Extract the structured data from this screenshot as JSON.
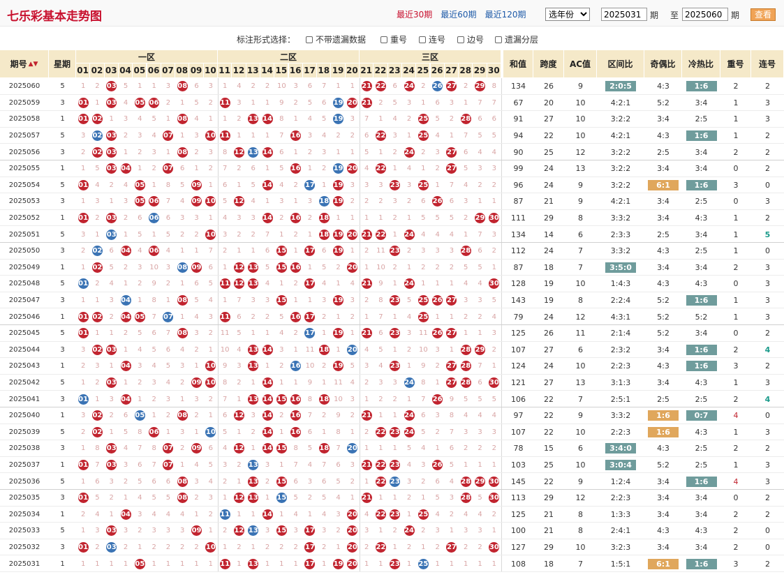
{
  "title": "七乐彩基本走势图",
  "ranges": [
    "最近30期",
    "最近60期",
    "最近120期"
  ],
  "year_select": "选年份",
  "period_from": "2025031",
  "period_to": "2025060",
  "label_qi": "期",
  "label_zhi": "至",
  "query_button": "查看",
  "mark_label": "标注形式选择：",
  "mark_options": [
    "不带遗漏数据",
    "重号",
    "连号",
    "边号",
    "遗漏分层"
  ],
  "zones": [
    "一区",
    "二区",
    "三区"
  ],
  "headers": {
    "period": "期号",
    "week": "星期",
    "sum": "和值",
    "span": "跨度",
    "ac": "AC值",
    "zone_ratio": "区间比",
    "odd_even": "奇偶比",
    "hot_cold": "冷热比",
    "repeat": "重号",
    "consecutive": "连号"
  },
  "sort_icon": "sort-icon",
  "colors": {
    "red_ball": "#c1242f",
    "blue_ball": "#3a73b4",
    "header_bg": "#f5e9c9",
    "teal_badge": "#6f9c9c",
    "orange_badge": "#e0a75c"
  },
  "rows": [
    {
      "p": "2025060",
      "w": "5",
      "red": [
        3,
        8,
        21,
        22,
        24,
        27,
        29
      ],
      "blue": [
        26
      ],
      "sum": "134",
      "span": "26",
      "ac": "9",
      "zr": "2:0:5",
      "oe": "4:3",
      "hc": "1:6",
      "rep": "2",
      "con": "2"
    },
    {
      "p": "2025059",
      "w": "3",
      "red": [
        1,
        3,
        5,
        6,
        11,
        20,
        21
      ],
      "blue": [
        19
      ],
      "sum": "67",
      "span": "20",
      "ac": "10",
      "zr": "4:2:1",
      "oe": "5:2",
      "hc": "3:4",
      "rep": "1",
      "con": "3"
    },
    {
      "p": "2025058",
      "w": "1",
      "red": [
        1,
        2,
        8,
        13,
        14,
        25,
        28
      ],
      "blue": [
        19
      ],
      "sum": "91",
      "span": "27",
      "ac": "10",
      "zr": "3:2:2",
      "oe": "3:4",
      "hc": "2:5",
      "rep": "1",
      "con": "3"
    },
    {
      "p": "2025057",
      "w": "5",
      "red": [
        3,
        7,
        10,
        11,
        16,
        22,
        25
      ],
      "blue": [
        2
      ],
      "sum": "94",
      "span": "22",
      "ac": "10",
      "zr": "4:2:1",
      "oe": "4:3",
      "hc": "1:6",
      "rep": "1",
      "con": "2"
    },
    {
      "p": "2025056",
      "w": "3",
      "red": [
        2,
        3,
        8,
        12,
        14,
        24,
        27
      ],
      "blue": [
        13
      ],
      "sum": "90",
      "span": "25",
      "ac": "12",
      "zr": "3:2:2",
      "oe": "2:5",
      "hc": "3:4",
      "rep": "2",
      "con": "2"
    },
    {
      "p": "2025055",
      "w": "1",
      "red": [
        3,
        4,
        7,
        16,
        20,
        22,
        27
      ],
      "blue": [
        19
      ],
      "sum": "99",
      "span": "24",
      "ac": "13",
      "zr": "3:2:2",
      "oe": "3:4",
      "hc": "3:4",
      "rep": "0",
      "con": "2"
    },
    {
      "p": "2025054",
      "w": "5",
      "red": [
        1,
        5,
        9,
        14,
        19,
        23,
        25
      ],
      "blue": [
        17
      ],
      "sum": "96",
      "span": "24",
      "ac": "9",
      "zr": "3:2:2",
      "oe": "6:1",
      "hc": "1:6",
      "rep": "3",
      "con": "0"
    },
    {
      "p": "2025053",
      "w": "3",
      "red": [
        5,
        6,
        9,
        10,
        12,
        19,
        26
      ],
      "blue": [
        18
      ],
      "sum": "87",
      "span": "21",
      "ac": "9",
      "zr": "4:2:1",
      "oe": "3:4",
      "hc": "2:5",
      "rep": "0",
      "con": "3"
    },
    {
      "p": "2025052",
      "w": "1",
      "red": [
        1,
        3,
        14,
        16,
        18,
        29,
        30
      ],
      "blue": [
        6
      ],
      "sum": "111",
      "span": "29",
      "ac": "8",
      "zr": "3:3:2",
      "oe": "3:4",
      "hc": "4:3",
      "rep": "1",
      "con": "2"
    },
    {
      "p": "2025051",
      "w": "5",
      "red": [
        10,
        18,
        19,
        20,
        21,
        22,
        24
      ],
      "blue": [
        3
      ],
      "sum": "134",
      "span": "14",
      "ac": "6",
      "zr": "2:3:3",
      "oe": "2:5",
      "hc": "3:4",
      "rep": "1",
      "con": "5"
    },
    {
      "p": "2025050",
      "w": "3",
      "red": [
        4,
        6,
        15,
        17,
        19,
        23,
        28
      ],
      "blue": [
        2
      ],
      "sum": "112",
      "span": "24",
      "ac": "7",
      "zr": "3:3:2",
      "oe": "4:3",
      "hc": "2:5",
      "rep": "1",
      "con": "0"
    },
    {
      "p": "2025049",
      "w": "1",
      "red": [
        2,
        9,
        12,
        13,
        15,
        16,
        20
      ],
      "blue": [
        8
      ],
      "sum": "87",
      "span": "18",
      "ac": "7",
      "zr": "3:5:0",
      "oe": "3:4",
      "hc": "3:4",
      "rep": "2",
      "con": "3"
    },
    {
      "p": "2025048",
      "w": "5",
      "red": [
        11,
        12,
        13,
        17,
        21,
        24,
        30
      ],
      "blue": [
        1
      ],
      "sum": "128",
      "span": "19",
      "ac": "10",
      "zr": "1:4:3",
      "oe": "4:3",
      "hc": "4:3",
      "rep": "0",
      "con": "3"
    },
    {
      "p": "2025047",
      "w": "3",
      "red": [
        8,
        15,
        19,
        23,
        25,
        26,
        27
      ],
      "blue": [
        4
      ],
      "sum": "143",
      "span": "19",
      "ac": "8",
      "zr": "2:2:4",
      "oe": "5:2",
      "hc": "1:6",
      "rep": "1",
      "con": "3"
    },
    {
      "p": "2025046",
      "w": "1",
      "red": [
        1,
        2,
        4,
        5,
        11,
        16,
        17,
        25
      ],
      "blue": [
        7
      ],
      "sum": "79",
      "span": "24",
      "ac": "12",
      "zr": "4:3:1",
      "oe": "5:2",
      "hc": "5:2",
      "rep": "1",
      "con": "3"
    },
    {
      "p": "2025045",
      "w": "5",
      "red": [
        1,
        8,
        19,
        21,
        23,
        26,
        27
      ],
      "blue": [
        17
      ],
      "sum": "125",
      "span": "26",
      "ac": "11",
      "zr": "2:1:4",
      "oe": "5:2",
      "hc": "3:4",
      "rep": "0",
      "con": "2"
    },
    {
      "p": "2025044",
      "w": "3",
      "red": [
        2,
        3,
        13,
        14,
        18,
        28,
        29
      ],
      "blue": [
        20
      ],
      "sum": "107",
      "span": "27",
      "ac": "6",
      "zr": "2:3:2",
      "oe": "3:4",
      "hc": "1:6",
      "rep": "2",
      "con": "4"
    },
    {
      "p": "2025043",
      "w": "1",
      "red": [
        4,
        10,
        13,
        19,
        23,
        27,
        28
      ],
      "blue": [
        16
      ],
      "sum": "124",
      "span": "24",
      "ac": "10",
      "zr": "2:2:3",
      "oe": "4:3",
      "hc": "1:6",
      "rep": "3",
      "con": "2"
    },
    {
      "p": "2025042",
      "w": "5",
      "red": [
        3,
        9,
        10,
        14,
        27,
        28,
        30
      ],
      "blue": [
        24
      ],
      "sum": "121",
      "span": "27",
      "ac": "13",
      "zr": "3:1:3",
      "oe": "3:4",
      "hc": "4:3",
      "rep": "1",
      "con": "3"
    },
    {
      "p": "2025041",
      "w": "3",
      "red": [
        4,
        13,
        14,
        15,
        16,
        18,
        26
      ],
      "blue": [
        1
      ],
      "sum": "106",
      "span": "22",
      "ac": "7",
      "zr": "2:5:1",
      "oe": "2:5",
      "hc": "2:5",
      "rep": "2",
      "con": "4"
    },
    {
      "p": "2025040",
      "w": "1",
      "red": [
        2,
        8,
        12,
        14,
        16,
        21,
        24
      ],
      "blue": [
        5
      ],
      "sum": "97",
      "span": "22",
      "ac": "9",
      "zr": "3:3:2",
      "oe": "1:6",
      "hc": "0:7",
      "rep": "4",
      "con": "0"
    },
    {
      "p": "2025039",
      "w": "5",
      "red": [
        2,
        6,
        14,
        16,
        22,
        23,
        24
      ],
      "blue": [
        10
      ],
      "sum": "107",
      "span": "22",
      "ac": "10",
      "zr": "2:2:3",
      "oe": "1:6",
      "hc": "4:3",
      "rep": "1",
      "con": "3"
    },
    {
      "p": "2025038",
      "w": "3",
      "red": [
        3,
        7,
        9,
        12,
        14,
        15,
        18
      ],
      "blue": [
        20
      ],
      "sum": "78",
      "span": "15",
      "ac": "6",
      "zr": "3:4:0",
      "oe": "4:3",
      "hc": "2:5",
      "rep": "2",
      "con": "2"
    },
    {
      "p": "2025037",
      "w": "1",
      "red": [
        1,
        3,
        7,
        21,
        22,
        23,
        26
      ],
      "blue": [
        13
      ],
      "sum": "103",
      "span": "25",
      "ac": "10",
      "zr": "3:0:4",
      "oe": "5:2",
      "hc": "2:5",
      "rep": "1",
      "con": "3"
    },
    {
      "p": "2025036",
      "w": "5",
      "red": [
        8,
        13,
        15,
        22,
        28,
        29,
        30
      ],
      "blue": [
        23
      ],
      "sum": "145",
      "span": "22",
      "ac": "9",
      "zr": "1:2:4",
      "oe": "3:4",
      "hc": "1:6",
      "rep": "4",
      "con": "3"
    },
    {
      "p": "2025035",
      "w": "3",
      "red": [
        1,
        8,
        12,
        13,
        21,
        28,
        30
      ],
      "blue": [
        15
      ],
      "sum": "113",
      "span": "29",
      "ac": "12",
      "zr": "2:2:3",
      "oe": "3:4",
      "hc": "3:4",
      "rep": "0",
      "con": "2"
    },
    {
      "p": "2025034",
      "w": "1",
      "red": [
        4,
        14,
        20,
        22,
        23,
        25
      ],
      "blue": [
        11
      ],
      "sum": "125",
      "span": "21",
      "ac": "8",
      "zr": "1:3:3",
      "oe": "3:4",
      "hc": "3:4",
      "rep": "2",
      "con": "2"
    },
    {
      "p": "2025033",
      "w": "5",
      "red": [
        3,
        9,
        12,
        15,
        17,
        20,
        24
      ],
      "blue": [
        13
      ],
      "sum": "100",
      "span": "21",
      "ac": "8",
      "zr": "2:4:1",
      "oe": "4:3",
      "hc": "4:3",
      "rep": "2",
      "con": "0"
    },
    {
      "p": "2025032",
      "w": "3",
      "red": [
        1,
        10,
        17,
        20,
        22,
        27,
        30
      ],
      "blue": [
        3
      ],
      "sum": "127",
      "span": "29",
      "ac": "10",
      "zr": "3:2:3",
      "oe": "3:4",
      "hc": "3:4",
      "rep": "2",
      "con": "0"
    },
    {
      "p": "2025031",
      "w": "1",
      "red": [
        5,
        11,
        13,
        17,
        19,
        20,
        23
      ],
      "blue": [
        25
      ],
      "sum": "108",
      "span": "18",
      "ac": "7",
      "zr": "1:5:1",
      "oe": "6:1",
      "hc": "1:6",
      "rep": "3",
      "con": "2"
    }
  ]
}
